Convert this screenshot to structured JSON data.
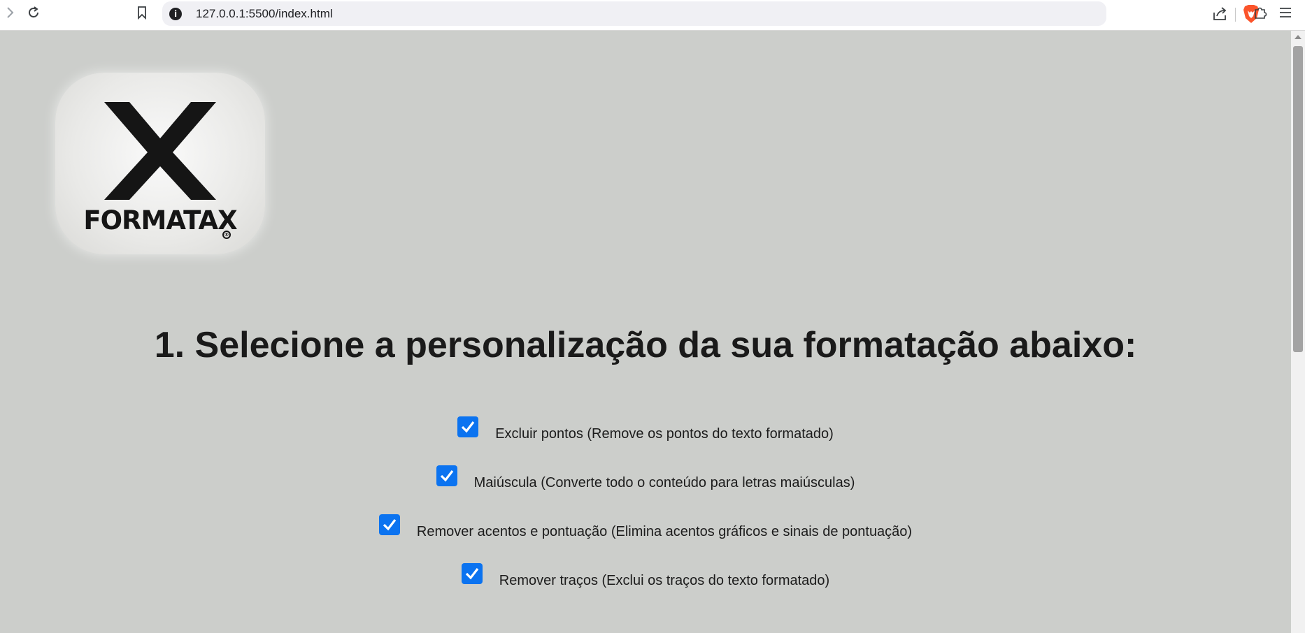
{
  "browser": {
    "url": "127.0.0.1:5500/index.html",
    "info_glyph": "i",
    "icons": [
      "forward-icon",
      "reload-icon",
      "bookmark-icon",
      "site-info-icon",
      "share-icon",
      "brave-shield-icon",
      "extensions-icon",
      "menu-icon"
    ]
  },
  "logo": {
    "text": "FORMATAX",
    "reg_mark": "®"
  },
  "heading": "1. Selecione a personalização da sua formatação abaixo:",
  "options": [
    {
      "label": "Excluir pontos (Remove os pontos do texto formatado)",
      "checked": true
    },
    {
      "label": "Maiúscula (Converte todo o conteúdo para letras maiúsculas)",
      "checked": true
    },
    {
      "label": "Remover acentos e pontuação (Elimina acentos gráficos e sinais de pontuação)",
      "checked": true
    },
    {
      "label": "Remover traços (Exclui os traços do texto formatado)",
      "checked": true
    }
  ],
  "colors": {
    "page_background": "#cccecb",
    "checkbox_accent": "#0b73f0",
    "brave_orange": "#fb542b"
  }
}
